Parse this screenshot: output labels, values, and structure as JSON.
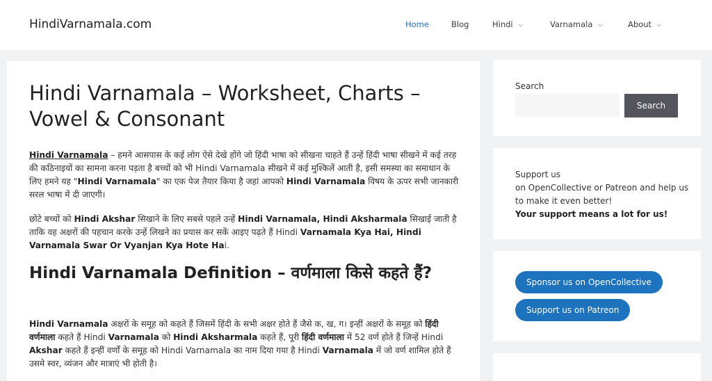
{
  "site": {
    "title": "HindiVarnamala.com"
  },
  "nav": {
    "items": [
      {
        "label": "Home",
        "has_dropdown": false,
        "active": true
      },
      {
        "label": "Blog",
        "has_dropdown": false,
        "active": false
      },
      {
        "label": "Hindi",
        "has_dropdown": true,
        "active": false
      },
      {
        "label": "Varnamala",
        "has_dropdown": true,
        "active": false
      },
      {
        "label": "About",
        "has_dropdown": true,
        "active": false
      }
    ],
    "caret_icon": "chevron-down-icon"
  },
  "article": {
    "title": "Hindi Varnamala – Worksheet, Charts – Vowel & Consonant",
    "p1": [
      {
        "text": "Hindi Varnamala",
        "style": "bu"
      },
      {
        "text": " – हमने आसपास के कई लोग ऐसे देखे होंगे जो हिंदी भाषा को सीखना चाहते हैं उन्हें हिंदी भाषा सीखने में कई तरह की कठिनाइयों का सामना करना पड़ता है बच्चों को भी Hindi Varnamala सीखने में कई मुश्किलें आती है, इसी समस्या का समाधान के लिए हमने यह \"",
        "style": "n"
      },
      {
        "text": "Hindi Varnamala",
        "style": "b"
      },
      {
        "text": "\" का एक पेज तैयार किया है जहां आपको ",
        "style": "n"
      },
      {
        "text": "Hindi Varnamala",
        "style": "b"
      },
      {
        "text": " विषय के ऊपर सभी जानकारी सरल भाषा में दी जाएगी।",
        "style": "n"
      }
    ],
    "p2": [
      {
        "text": "छोटे बच्चों को ",
        "style": "n"
      },
      {
        "text": "Hindi Akshar",
        "style": "b"
      },
      {
        "text": " सिखाने के लिए सबसे पहले उन्हें ",
        "style": "n"
      },
      {
        "text": "Hindi Varnamala, Hindi Aksharmala",
        "style": "b"
      },
      {
        "text": " सिखाई जाती है ताकि वह अक्षरों की पहचान करके उन्हें लिखने का प्रयास कर सकें आइए पढ़ते हैं Hindi ",
        "style": "n"
      },
      {
        "text": "Varnamala Kya Hai, Hindi Varnamala Swar Or Vyanjan Kya Hote Ha",
        "style": "b"
      },
      {
        "text": "i.",
        "style": "n"
      }
    ],
    "heading": "Hindi Varnamala Definition – वर्णमाला किसे कहते हैं?",
    "p3": [
      {
        "text": "Hindi Varnamala",
        "style": "b"
      },
      {
        "text": " अक्षरों के समूह को कहते हैं जिसमें हिंदी के सभी अक्षर होते हैं जैसे क, ख, ग। इन्हीं अक्षरों के समूह को ",
        "style": "n"
      },
      {
        "text": "हिंदी वर्णमाला",
        "style": "b"
      },
      {
        "text": " कहते हैं Hindi ",
        "style": "n"
      },
      {
        "text": "Varnamala",
        "style": "b"
      },
      {
        "text": " को ",
        "style": "n"
      },
      {
        "text": "Hindi Aksharmala",
        "style": "b"
      },
      {
        "text": " कहते हैं, पूरी ",
        "style": "n"
      },
      {
        "text": "हिंदी वर्णमाला",
        "style": "b"
      },
      {
        "text": " में 52 वर्ण होते हैं जिन्हें Hindi ",
        "style": "n"
      },
      {
        "text": "Akshar",
        "style": "b"
      },
      {
        "text": " कहते हैं इन्हीं वर्णों के समूह को Hindi Varnamala का नाम दिया गया है Hindi ",
        "style": "n"
      },
      {
        "text": "Varnamala",
        "style": "b"
      },
      {
        "text": " में जो वर्ण शामिल होते हैं उसमे स्वर, व्यंजन और मात्राएं भी होती है।",
        "style": "n"
      }
    ]
  },
  "sidebar": {
    "search": {
      "label": "Search",
      "placeholder": "",
      "value": "",
      "button_label": "Search"
    },
    "support": {
      "line1": "Support us",
      "line2": "on OpenCollective or Patreon and help us to make it even better!",
      "line3": "Your support means a lot for us!"
    },
    "buttons": {
      "opencollective": "Sponsor us on OpenCollective",
      "patreon": "Support us on Patreon"
    }
  },
  "colors": {
    "accent": "#1e73be",
    "search_button": "#55555e",
    "page_background": "#f1f2f3"
  }
}
